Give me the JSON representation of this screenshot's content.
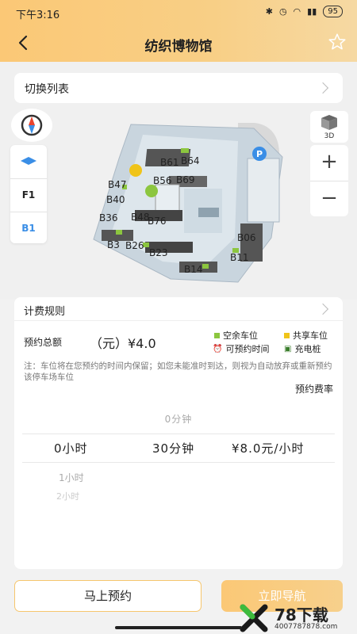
{
  "status": {
    "time": "下午3:16",
    "battery": "95"
  },
  "nav": {
    "title": "纺织博物馆"
  },
  "switch_list": {
    "label": "切换列表"
  },
  "map": {
    "floors": [
      "F1",
      "B1"
    ],
    "active_floor": "B1",
    "view_3d_label": "3D",
    "zoom_in": "+",
    "zoom_out": "−",
    "spot_labels": [
      "B47",
      "B61",
      "B64",
      "B56",
      "B69",
      "B40",
      "B36",
      "B48",
      "B76",
      "B3",
      "B26",
      "B23",
      "B14",
      "B06",
      "B11"
    ]
  },
  "sheet": {
    "fee_rule_label": "计费规则",
    "total_label": "预约总额",
    "total_value": "（元）¥4.0",
    "legend": {
      "empty": "空余车位",
      "shared": "共享车位",
      "reservable": "可预约时间",
      "charging": "充电桩"
    },
    "note": "注：车位将在您预约的时间内保留；如您未能准时到达，则视为自动放弃或重新预约该停车场车位",
    "rate_label": "预约费率",
    "picker": {
      "ghost_top": "0分钟",
      "hours": "0小时",
      "minutes": "30分钟",
      "rate": "¥8.0元/小时",
      "ghost_next": "1小时",
      "ghost_next2": "2小时"
    }
  },
  "actions": {
    "reserve": "马上预约",
    "navigate": "立即导航"
  },
  "watermark": {
    "text": "78下载",
    "url": "4007787878.com"
  },
  "colors": {
    "accent": "#f8c878",
    "empty_spot": "#8cc63f",
    "shared_spot": "#f0c419"
  }
}
